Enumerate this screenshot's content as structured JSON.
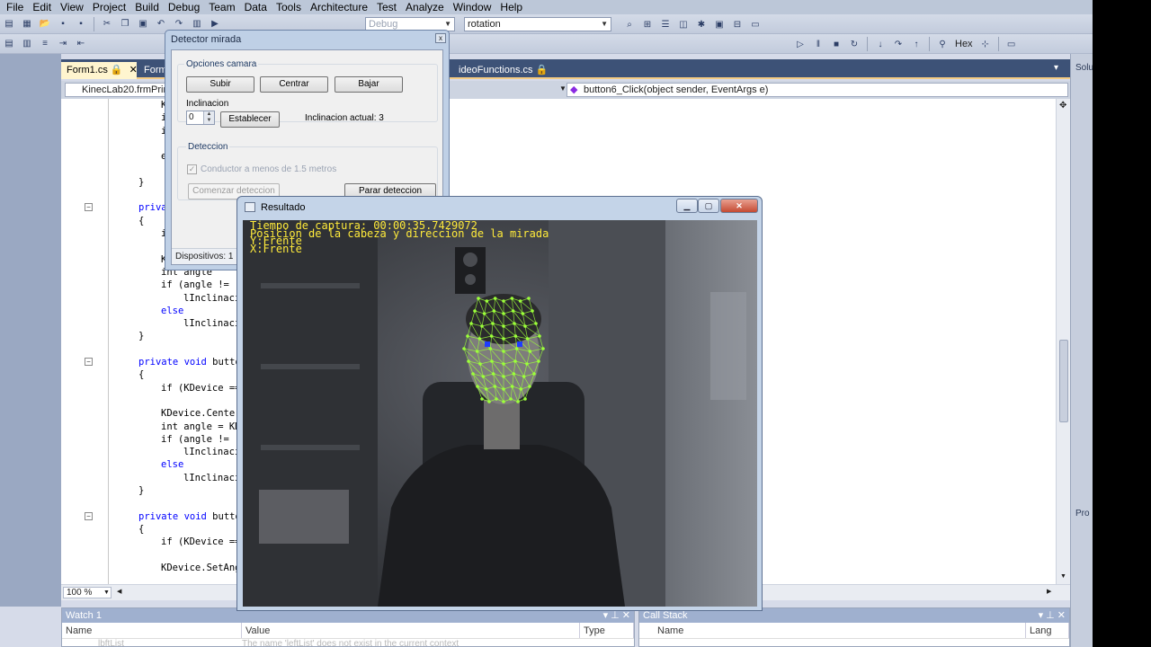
{
  "menu": [
    "File",
    "Edit",
    "View",
    "Project",
    "Build",
    "Debug",
    "Team",
    "Data",
    "Tools",
    "Architecture",
    "Test",
    "Analyze",
    "Window",
    "Help"
  ],
  "toolbar": {
    "config_combo": "Debug",
    "find_combo": "rotation",
    "hex_label": "Hex"
  },
  "doc_tabs": [
    {
      "label": "Form1.cs",
      "active": true
    },
    {
      "label": "Form1",
      "active": false
    },
    {
      "label": "ideoFunctions.cs",
      "active": false
    }
  ],
  "nav": {
    "class_combo": "KinecLab20.frmPrin",
    "member_combo": "button6_Click(object sender, EventArgs e)"
  },
  "code_lines": [
    {
      "text": "K",
      "indent": 4,
      "kind": "plain"
    },
    {
      "text": "i",
      "indent": 4,
      "kind": "plain"
    },
    {
      "text": "i",
      "indent": 4,
      "kind": "plain"
    },
    {
      "text": "",
      "indent": 0,
      "kind": "plain"
    },
    {
      "text": "e",
      "indent": 4,
      "kind": "plain"
    },
    {
      "text": "",
      "indent": 0,
      "kind": "plain"
    },
    {
      "text": "}",
      "indent": 3,
      "kind": "plain"
    },
    {
      "text": "",
      "indent": 0,
      "kind": "plain"
    },
    {
      "text": "private",
      "indent": 3,
      "kind": "kw"
    },
    {
      "text": "{",
      "indent": 3,
      "kind": "plain"
    },
    {
      "text": "i",
      "indent": 4,
      "kind": "plain"
    },
    {
      "text": "",
      "indent": 0,
      "kind": "plain"
    },
    {
      "text": "K",
      "indent": 4,
      "kind": "plain"
    },
    {
      "text": "int angle",
      "indent": 4,
      "kind": "plain"
    },
    {
      "text": "if (angle != ",
      "indent": 4,
      "kind": "plain"
    },
    {
      "text": "lInclinaci",
      "indent": 5,
      "kind": "plain"
    },
    {
      "text": "else",
      "indent": 4,
      "kind": "kw"
    },
    {
      "text": "lInclinaci",
      "indent": 5,
      "kind": "plain"
    },
    {
      "text": "}",
      "indent": 3,
      "kind": "plain"
    },
    {
      "text": "",
      "indent": 0,
      "kind": "plain"
    },
    {
      "text": "private void butto",
      "indent": 3,
      "kind": "kw"
    },
    {
      "text": "{",
      "indent": 3,
      "kind": "plain"
    },
    {
      "text": "if (KDevice ==",
      "indent": 4,
      "kind": "plain"
    },
    {
      "text": "",
      "indent": 0,
      "kind": "plain"
    },
    {
      "text": "KDevice.Center",
      "indent": 4,
      "kind": "plain"
    },
    {
      "text": "int angle = KD",
      "indent": 4,
      "kind": "plain"
    },
    {
      "text": "if (angle != ",
      "indent": 4,
      "kind": "plain"
    },
    {
      "text": "lInclinaci",
      "indent": 5,
      "kind": "plain"
    },
    {
      "text": "else",
      "indent": 4,
      "kind": "kw"
    },
    {
      "text": "lInclinaci",
      "indent": 5,
      "kind": "plain"
    },
    {
      "text": "}",
      "indent": 3,
      "kind": "plain"
    },
    {
      "text": "",
      "indent": 0,
      "kind": "plain"
    },
    {
      "text": "private void butto",
      "indent": 3,
      "kind": "kw"
    },
    {
      "text": "{",
      "indent": 3,
      "kind": "plain"
    },
    {
      "text": "if (KDevice ==",
      "indent": 4,
      "kind": "plain"
    },
    {
      "text": "",
      "indent": 0,
      "kind": "plain"
    },
    {
      "text": "KDevice.SetAng",
      "indent": 4,
      "kind": "plain"
    }
  ],
  "editor": {
    "zoom": "100 %"
  },
  "watch": {
    "title": "Watch 1",
    "col_name": "Name",
    "col_value": "Value",
    "col_type": "Type",
    "row_name": "lbftList",
    "row_value": "The name 'leftList' does not exist in the current context"
  },
  "callstack": {
    "title": "Call Stack",
    "col_name": "Name",
    "col_lang": "Lang"
  },
  "right_strip": {
    "top_label": "Solu",
    "bottom_label": "Pro"
  },
  "detector": {
    "title": "Detector mirada",
    "close": "x",
    "camera_group": "Opciones camara",
    "btn_up": "Subir",
    "btn_center": "Centrar",
    "btn_down": "Bajar",
    "tilt_label": "Inclinacion",
    "tilt_value": "0",
    "btn_set": "Establecer",
    "current_tilt": "Inclinacion actual: 3",
    "detection_group": "Deteccion",
    "near_checkbox": "Conductor a menos de 1.5 metros",
    "near_checked": true,
    "btn_start": "Comenzar deteccion",
    "btn_stop": "Parar deteccion",
    "status": "Dispositivos: 1"
  },
  "resultado": {
    "title": "Resultado",
    "overlay": [
      "Tiempo de captura: 00:00:35.7429072",
      "Posicion de la cabeza y direccion de la mirada",
      "Y:Frente",
      "X:Frente"
    ],
    "mesh_color": "#9cff3a",
    "eye_color": "#1f3cff"
  }
}
